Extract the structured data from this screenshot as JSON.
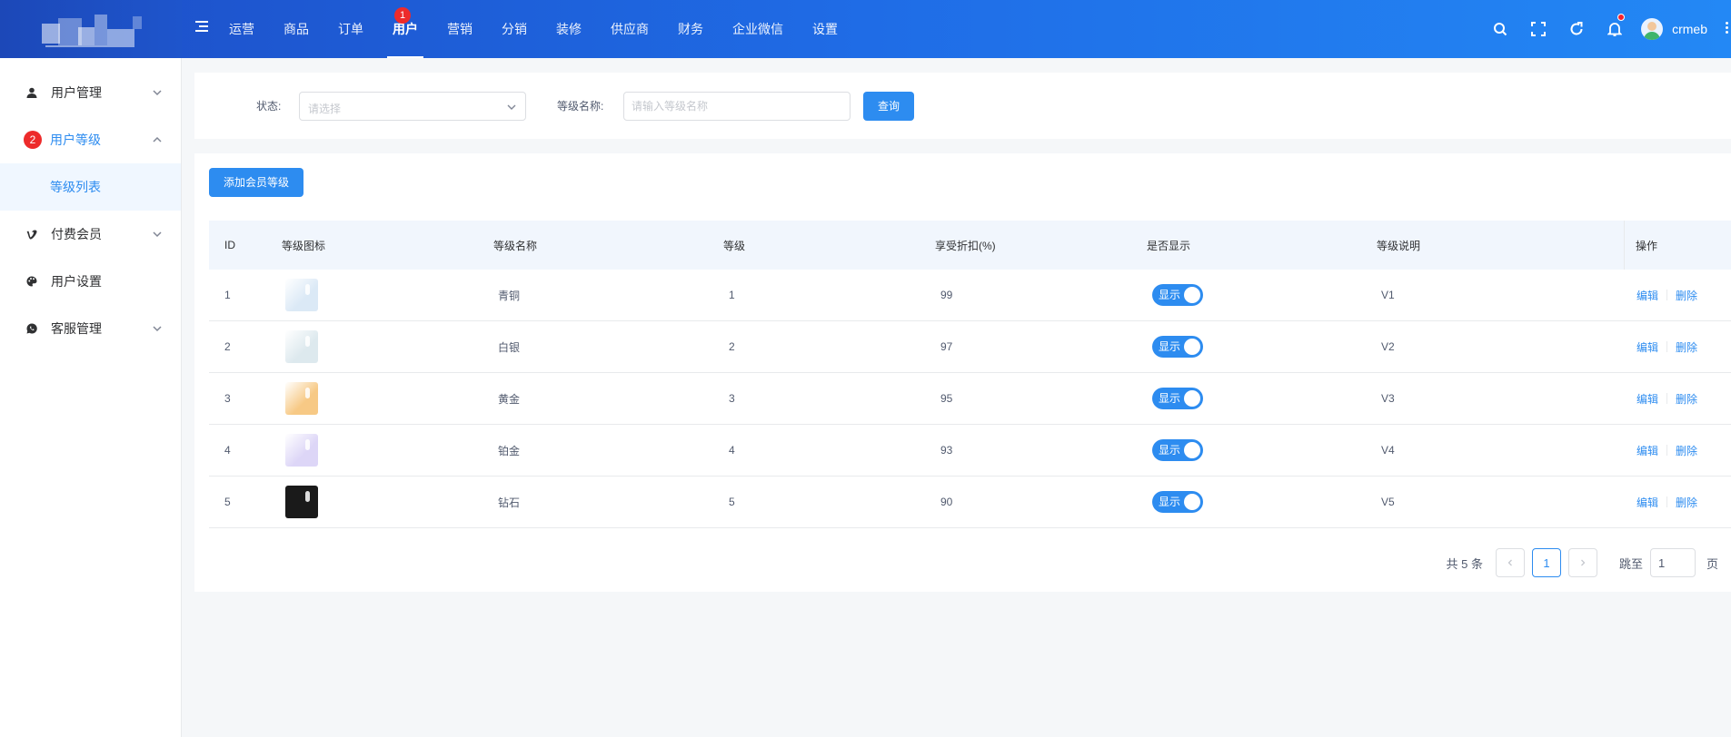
{
  "header": {
    "nav": [
      {
        "label": "运营",
        "active": false
      },
      {
        "label": "商品",
        "active": false
      },
      {
        "label": "订单",
        "active": false
      },
      {
        "label": "用户",
        "active": true
      },
      {
        "label": "营销",
        "active": false
      },
      {
        "label": "分销",
        "active": false
      },
      {
        "label": "装修",
        "active": false
      },
      {
        "label": "供应商",
        "active": false
      },
      {
        "label": "财务",
        "active": false
      },
      {
        "label": "企业微信",
        "active": false
      },
      {
        "label": "设置",
        "active": false
      }
    ],
    "nav_badge": "1",
    "username": "crmeb"
  },
  "sidebar": {
    "items": [
      {
        "label": "用户管理",
        "icon": "user-icon"
      },
      {
        "label": "用户等级",
        "icon": "badge",
        "badge": "2"
      },
      {
        "label": "付费会员",
        "icon": "vimeo-icon"
      },
      {
        "label": "用户设置",
        "icon": "palette-icon"
      },
      {
        "label": "客服管理",
        "icon": "chat-icon"
      }
    ],
    "sub_item": "等级列表"
  },
  "filter": {
    "status_label": "状态:",
    "status_placeholder": "请选择",
    "name_label": "等级名称:",
    "name_placeholder": "请输入等级名称",
    "query_button": "查询"
  },
  "toolbar": {
    "add_button": "添加会员等级"
  },
  "table": {
    "headers": [
      "ID",
      "等级图标",
      "等级名称",
      "等级",
      "享受折扣(%)",
      "是否显示",
      "等级说明",
      "操作"
    ],
    "rows": [
      {
        "id": "1",
        "icon_color": "#dbe9f6",
        "name": "青铜",
        "grade": "1",
        "discount": "99",
        "show": "显示",
        "desc": "V1"
      },
      {
        "id": "2",
        "icon_color": "#dde9ee",
        "name": "白银",
        "grade": "2",
        "discount": "97",
        "show": "显示",
        "desc": "V2"
      },
      {
        "id": "3",
        "icon_color": "#f7c985",
        "name": "黄金",
        "grade": "3",
        "discount": "95",
        "show": "显示",
        "desc": "V3"
      },
      {
        "id": "4",
        "icon_color": "#ddd6f7",
        "name": "铂金",
        "grade": "4",
        "discount": "93",
        "show": "显示",
        "desc": "V4"
      },
      {
        "id": "5",
        "icon_color": "#1a1a1a",
        "name": "钻石",
        "grade": "5",
        "discount": "90",
        "show": "显示",
        "desc": "V5"
      }
    ],
    "edit_label": "编辑",
    "delete_label": "删除"
  },
  "pagination": {
    "total": "共 5 条",
    "current": "1",
    "jump_label": "跳至",
    "jump_value": "1",
    "page_suffix": "页"
  },
  "colors": {
    "primary": "#2d8cf0",
    "header_start": "#1d4ec7",
    "header_end": "#2388f5",
    "badge": "#ed2b2b"
  }
}
